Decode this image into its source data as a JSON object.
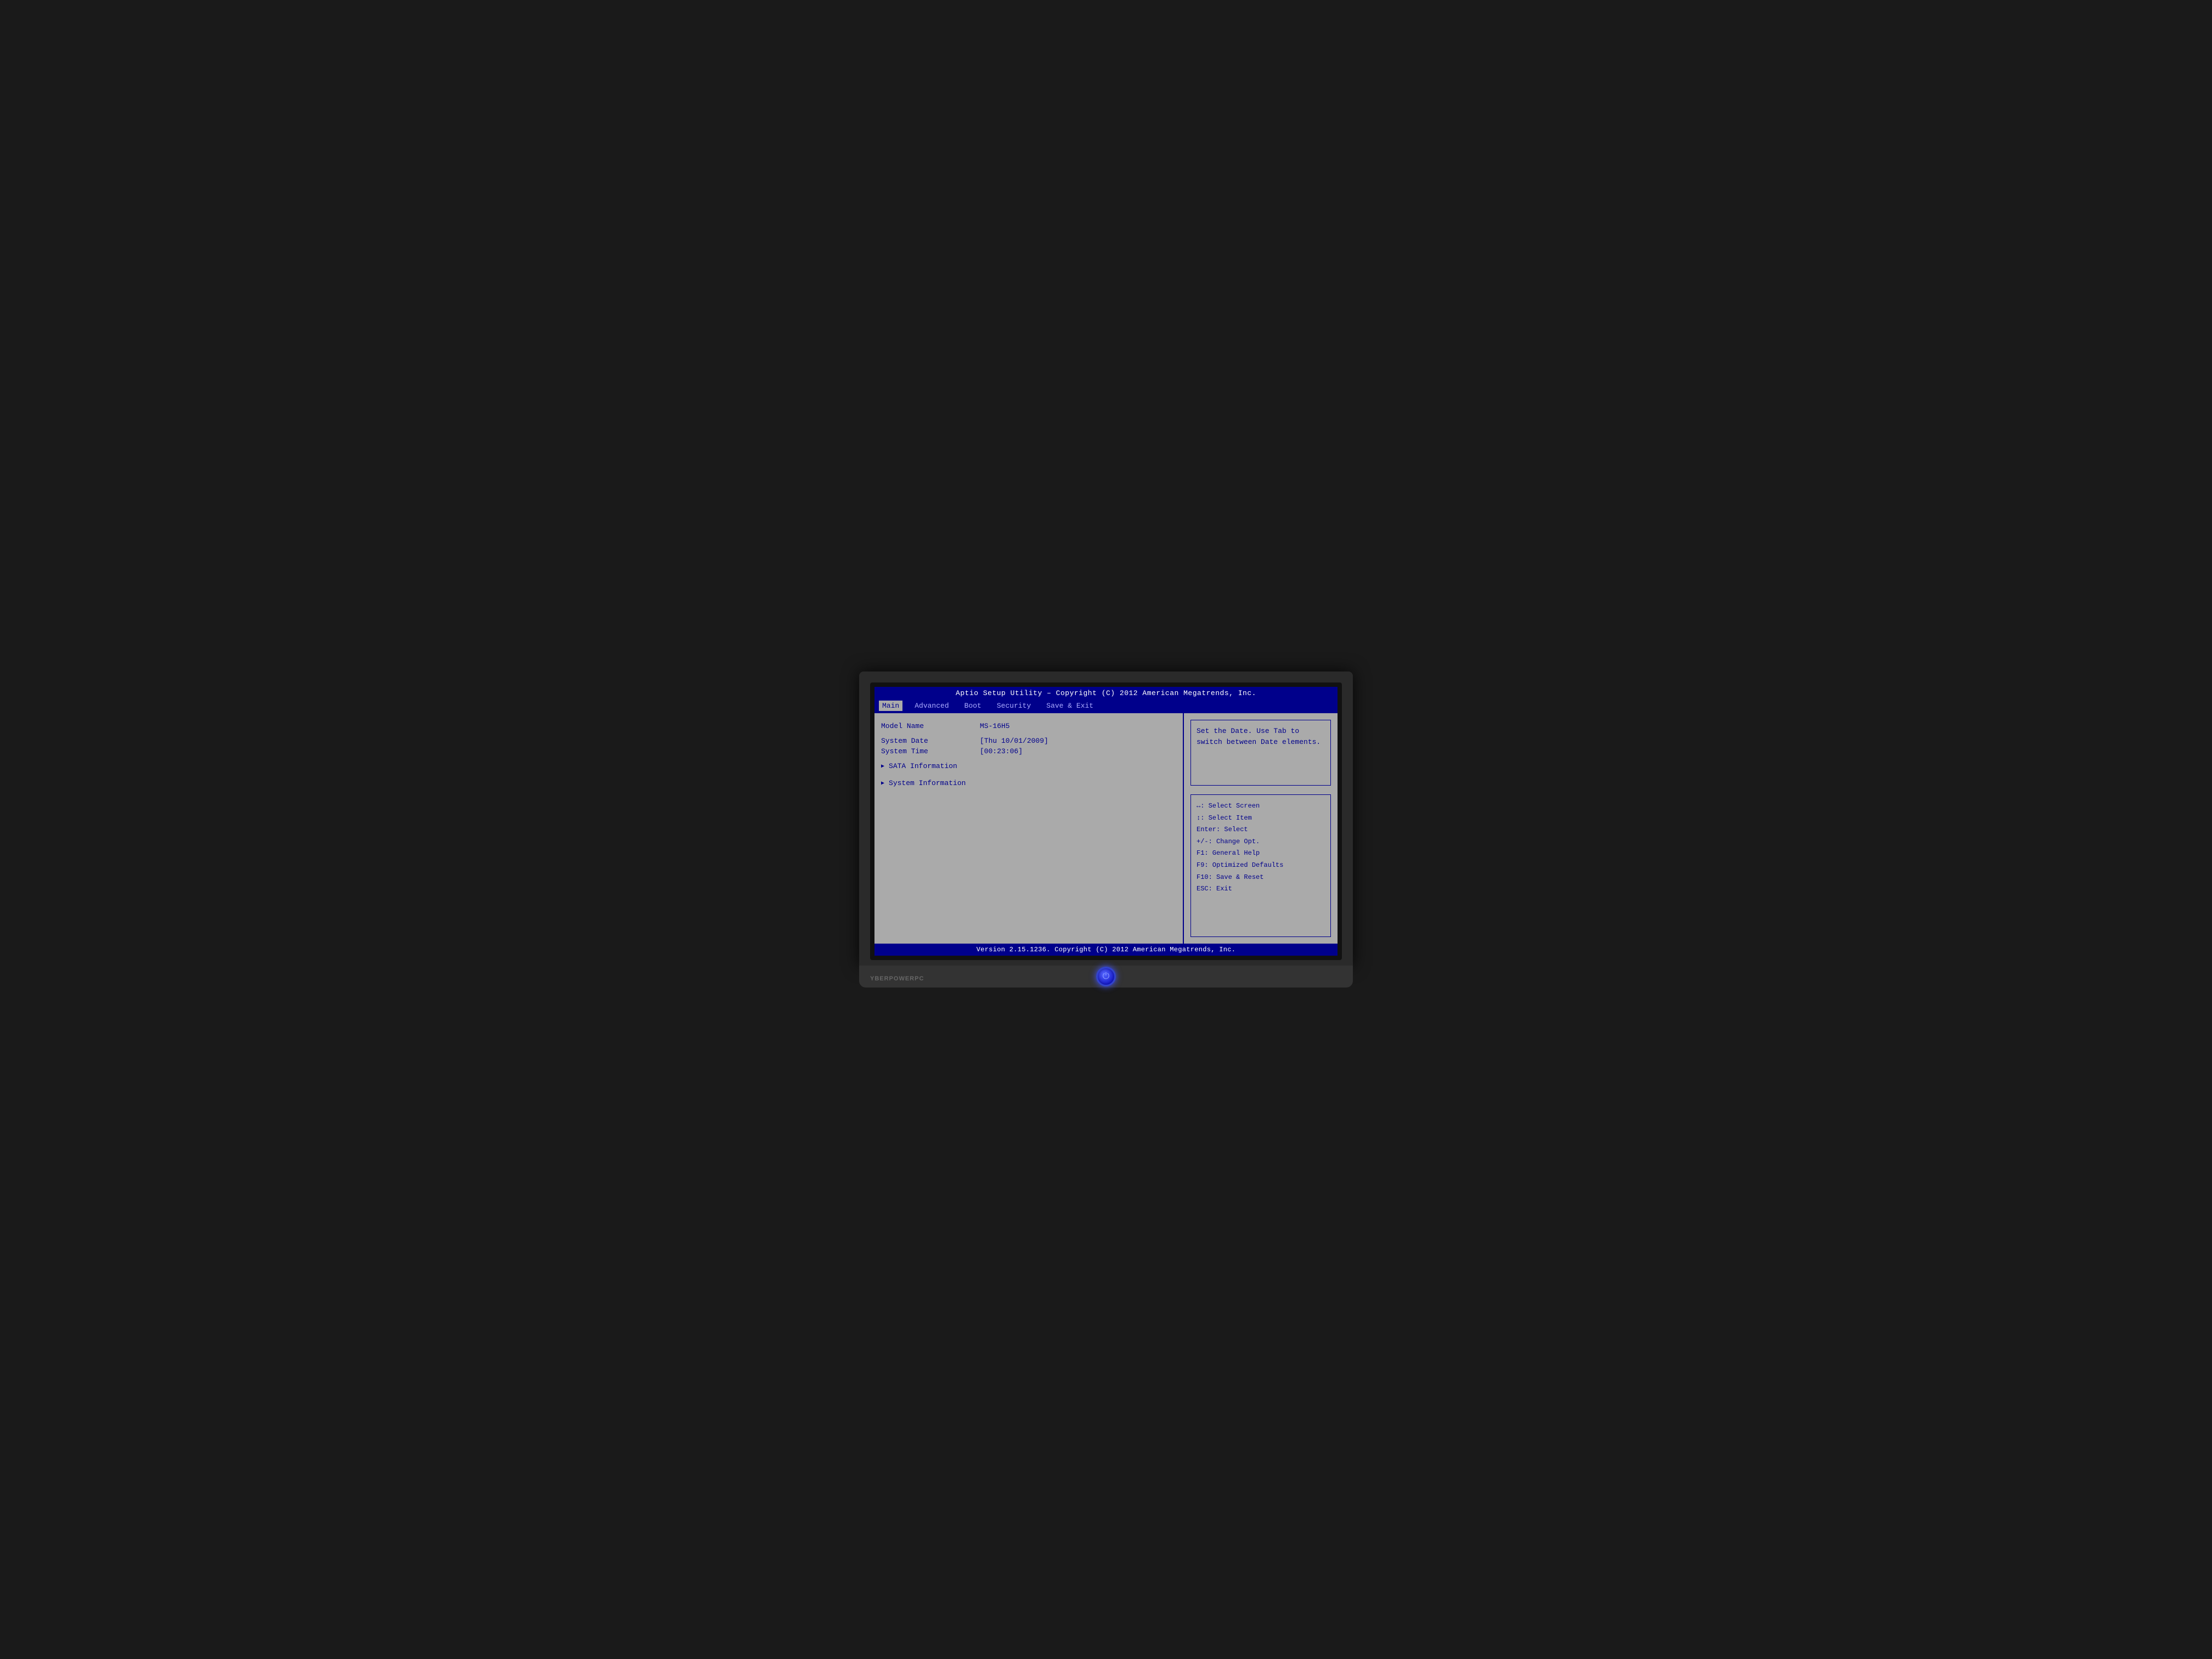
{
  "bios": {
    "title": "Aptio Setup Utility – Copyright (C) 2012 American Megatrends, Inc.",
    "footer": "Version 2.15.1236. Copyright (C) 2012 American Megatrends, Inc.",
    "nav": {
      "items": [
        {
          "label": "Main",
          "active": true
        },
        {
          "label": "Advanced",
          "active": false
        },
        {
          "label": "Boot",
          "active": false
        },
        {
          "label": "Security",
          "active": false
        },
        {
          "label": "Save & Exit",
          "active": false
        }
      ]
    },
    "main": {
      "model_name_label": "Model Name",
      "model_name_value": "MS-16H5",
      "system_date_label": "System Date",
      "system_date_value": "[Thu 10/01/2009]",
      "system_time_label": "System Time",
      "system_time_value": "[00:23:06]",
      "sata_label": "SATA Information",
      "system_info_label": "System Information"
    },
    "help": {
      "text": "Set the Date. Use Tab to switch between Date elements."
    },
    "keys": {
      "lines": [
        "↔: Select Screen",
        "↕: Select Item",
        "Enter: Select",
        "+/-: Change Opt.",
        "F1: General Help",
        "F9: Optimized Defaults",
        "F10: Save & Reset",
        "ESC: Exit"
      ]
    }
  },
  "laptop": {
    "brand": "YBERPOWERPC"
  }
}
